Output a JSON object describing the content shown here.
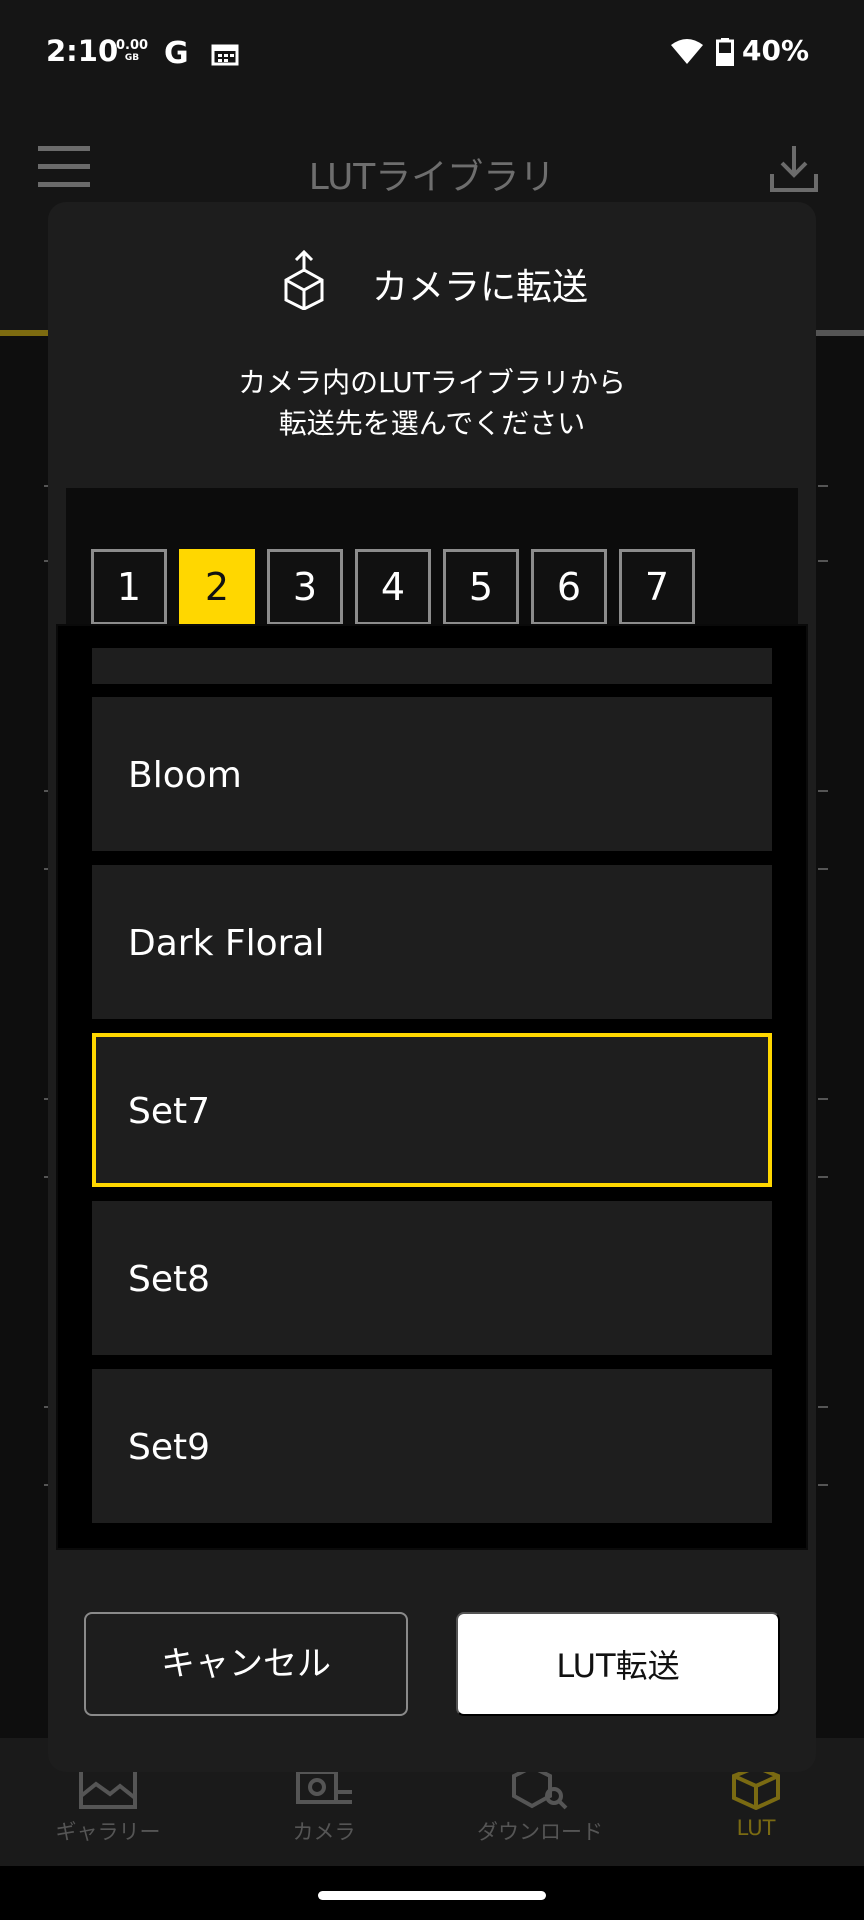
{
  "status": {
    "time": "2:10",
    "data_value": "0.00",
    "data_unit": "GB",
    "google": "G",
    "battery": "40%"
  },
  "header": {
    "title": "LUTライブラリ"
  },
  "dialog": {
    "title": "カメラに転送",
    "desc_line1": "カメラ内のLUTライブラリから",
    "desc_line2": "転送先を選んでください",
    "slots": [
      "1",
      "2",
      "3",
      "4",
      "5",
      "6",
      "7"
    ],
    "selected_slot": "2",
    "items": [
      "Bloom",
      "Dark Floral",
      "Set7",
      "Set8",
      "Set9"
    ],
    "selected_item": "Set7",
    "cancel_label": "キャンセル",
    "transfer_label": "LUT転送"
  },
  "bottom_nav": {
    "gallery": "ギャラリー",
    "camera": "カメラ",
    "download": "ダウンロード",
    "lut": "LUT"
  },
  "colors": {
    "accent": "#ffd700",
    "dialog_bg": "#1d1d1d"
  }
}
